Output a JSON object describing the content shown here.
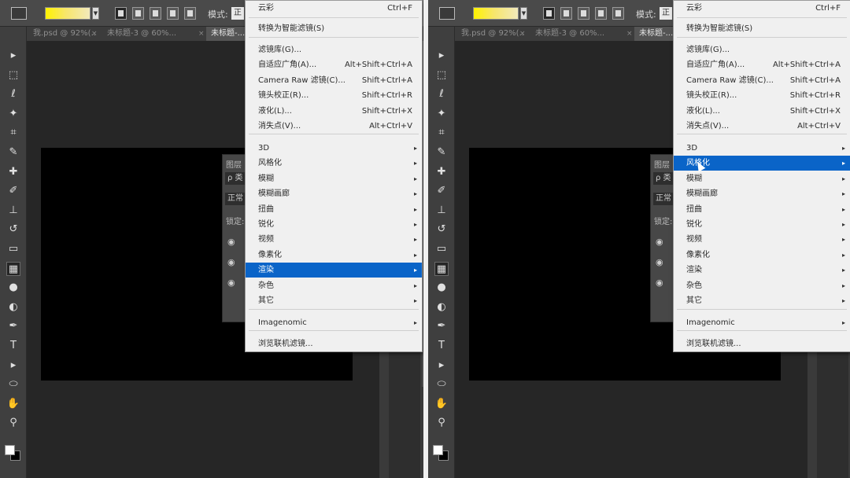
{
  "options_bar": {
    "mode_label": "模式:",
    "mode_value": "正常"
  },
  "tabs": [
    {
      "label": "我.psd @ 92%(...",
      "close": "×"
    },
    {
      "label": "未标题-3 @ 60%...",
      "close": "×"
    },
    {
      "label": "未标题-...",
      "close": ""
    }
  ],
  "layers_panel": {
    "title": "图层",
    "search": "ρ 类",
    "mode": "正常",
    "lock": "锁定:"
  },
  "tools": {
    "move": "▸",
    "marquee": "⬚",
    "lasso": "ℓ",
    "quick_select": "✦",
    "crop": "⌗",
    "eyedropper": "✎",
    "heal": "✚",
    "brush": "✐",
    "stamp": "⊥",
    "history": "↺",
    "eraser": "▭",
    "gradient": "▦",
    "blur": "●",
    "dodge": "◐",
    "pen": "✒",
    "type": "T",
    "path_select": "▸",
    "shape": "⬭",
    "hand": "✋",
    "zoom": "⚲",
    "mask": "▣"
  },
  "menu": {
    "items": [
      {
        "label": "云彩",
        "shortcut": "Ctrl+F",
        "arrow": ""
      },
      {
        "label": "转换为智能滤镜(S)",
        "shortcut": "",
        "arrow": ""
      },
      {
        "label": "滤镜库(G)...",
        "shortcut": "",
        "arrow": ""
      },
      {
        "label": "自适应广角(A)...",
        "shortcut": "Alt+Shift+Ctrl+A",
        "arrow": ""
      },
      {
        "label": "Camera Raw 滤镜(C)...",
        "shortcut": "Shift+Ctrl+A",
        "arrow": ""
      },
      {
        "label": "镜头校正(R)...",
        "shortcut": "Shift+Ctrl+R",
        "arrow": ""
      },
      {
        "label": "液化(L)...",
        "shortcut": "Shift+Ctrl+X",
        "arrow": ""
      },
      {
        "label": "消失点(V)...",
        "shortcut": "Alt+Ctrl+V",
        "arrow": ""
      },
      {
        "label": "3D",
        "shortcut": "",
        "arrow": "▸"
      },
      {
        "label": "风格化",
        "shortcut": "",
        "arrow": "▸"
      },
      {
        "label": "模糊",
        "shortcut": "",
        "arrow": "▸"
      },
      {
        "label": "模糊画廊",
        "shortcut": "",
        "arrow": "▸"
      },
      {
        "label": "扭曲",
        "shortcut": "",
        "arrow": "▸"
      },
      {
        "label": "锐化",
        "shortcut": "",
        "arrow": "▸"
      },
      {
        "label": "视频",
        "shortcut": "",
        "arrow": "▸"
      },
      {
        "label": "像素化",
        "shortcut": "",
        "arrow": "▸"
      },
      {
        "label": "渲染",
        "shortcut": "",
        "arrow": "▸"
      },
      {
        "label": "杂色",
        "shortcut": "",
        "arrow": "▸"
      },
      {
        "label": "其它",
        "shortcut": "",
        "arrow": "▸"
      },
      {
        "label": "Imagenomic",
        "shortcut": "",
        "arrow": "▸"
      },
      {
        "label": "浏览联机滤镜...",
        "shortcut": "",
        "arrow": ""
      }
    ],
    "highlighted_left": "渲染",
    "highlighted_right": "风格化",
    "highlight_color": "#0a64c8"
  },
  "colors": {
    "foreground": "#ffffff",
    "background": "#000000",
    "gradient_start": "#fff200",
    "gradient_end": "#f2e9bb"
  }
}
